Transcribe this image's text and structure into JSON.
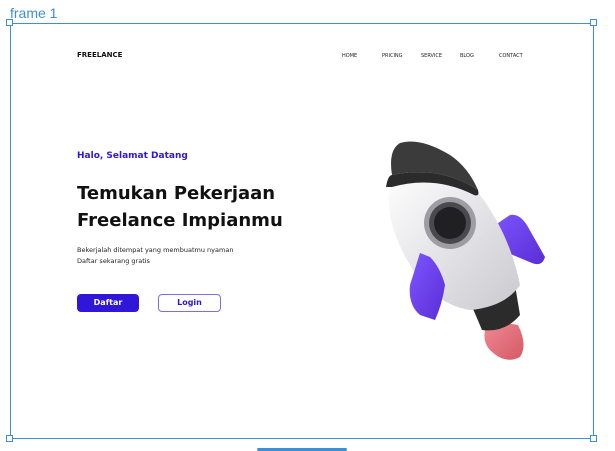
{
  "editor": {
    "frame_label": "frame 1"
  },
  "header": {
    "logo": "FREELANCE",
    "nav": [
      "HOME",
      "PRICING",
      "SERVICE",
      "BLOG",
      "CONTACT"
    ]
  },
  "hero": {
    "greeting": "Halo, Selamat Datang",
    "headline_line1": "Temukan Pekerjaan",
    "headline_line2": "Freelance Impianmu",
    "desc_line1": "Bekerjalah ditempat yang membuatmu nyaman",
    "desc_line2": "Daftar sekarang gratis",
    "primary_button": "Daftar",
    "secondary_button": "Login"
  },
  "colors": {
    "accent": "#2f16d8",
    "selection": "#3d8fd6",
    "rocket_body": "#e9e9ec",
    "rocket_nose": "#3a3a3a",
    "rocket_fin": "#6a3df0",
    "rocket_flame": "#e3707a"
  }
}
